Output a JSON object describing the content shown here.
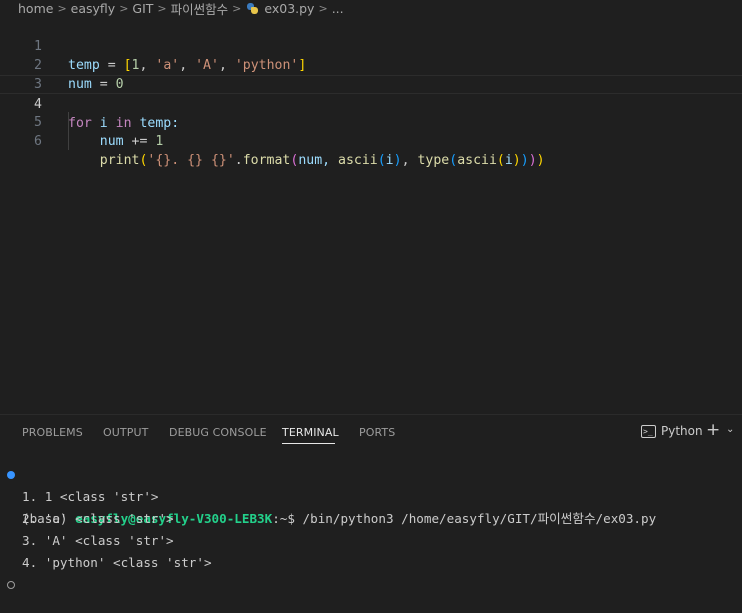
{
  "breadcrumb": {
    "items": [
      "home",
      "easyfly",
      "GIT",
      "파이썬함수"
    ],
    "file": "ex03.py",
    "ellipsis": "..."
  },
  "editor": {
    "line_numbers": [
      "1",
      "2",
      "3",
      "4",
      "5",
      "6"
    ],
    "lines": {
      "l1": {
        "var": "temp",
        "op": " = ",
        "open": "[",
        "n1": "1",
        "c1": ", ",
        "s1": "'a'",
        "c2": ", ",
        "s2": "'A'",
        "c3": ", ",
        "s3": "'python'",
        "close": "]"
      },
      "l2": {
        "var": "num",
        "op": " = ",
        "n": "0"
      },
      "l4": {
        "kw_for": "for",
        "v_i": " i ",
        "kw_in": "in",
        "rest": " temp:"
      },
      "l5": {
        "indent": "    ",
        "var": "num",
        "op": " += ",
        "n": "1"
      },
      "l6": {
        "indent": "    ",
        "fn": "print",
        "p1": "(",
        "s": "'{}. {} {}'",
        "dot": ".",
        "fmt": "format",
        "p2": "(",
        "a1": "num, ",
        "fa": "ascii",
        "p3": "(",
        "i1": "i",
        "p3c": ")",
        "c": ", ",
        "ft": "type",
        "p4": "(",
        "fa2": "ascii",
        "p5": "(",
        "i2": "i",
        "p5c": ")",
        "p4c": ")",
        "p2c": ")",
        "p1c": ")"
      }
    }
  },
  "panel": {
    "tabs": [
      "PROBLEMS",
      "OUTPUT",
      "DEBUG CONSOLE",
      "TERMINAL",
      "PORTS"
    ],
    "active_tab": "TERMINAL",
    "terminal_name": "Python",
    "terminal_icon_text": ">_",
    "plus": "+",
    "chevron": "⌄"
  },
  "terminal": {
    "prompt_base": "(base) ",
    "prompt_user": "easyfly@easyfly-V300-LEB3K",
    "prompt_suffix": ":~$",
    "command": " /bin/python3 /home/easyfly/GIT/파이썬함수/ex03.py",
    "output": [
      "1. 1 <class 'str'>",
      "2. 'a' <class 'str'>",
      "3. 'A' <class 'str'>",
      "4. 'python' <class 'str'>"
    ]
  }
}
